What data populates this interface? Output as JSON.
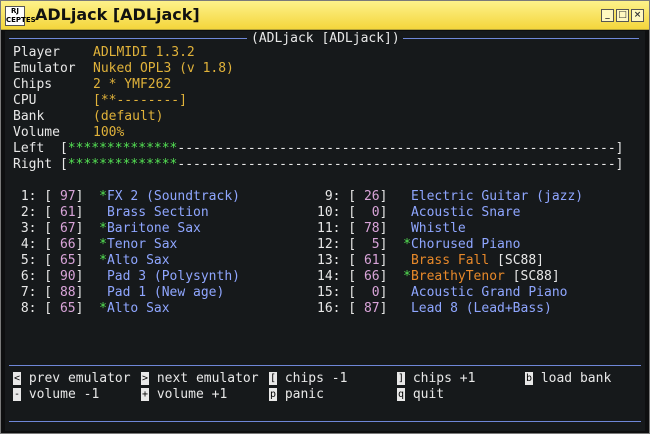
{
  "window": {
    "title": "ADLjack [ADLjack]",
    "app_icon_text": "RJ CEPTES"
  },
  "header": {
    "title": "(ADLjack [ADLjack])"
  },
  "info": [
    {
      "label": "Player",
      "value": "ADLMIDI 1.3.2"
    },
    {
      "label": "Emulator",
      "value": "Nuked OPL3 (v 1.8)"
    },
    {
      "label": "Chips",
      "value": "2 * YMF262"
    },
    {
      "label": "CPU",
      "value": "[**--------]"
    },
    {
      "label": "Bank",
      "value": "(default)"
    },
    {
      "label": "Volume",
      "value": "100%"
    }
  ],
  "meters": {
    "left": {
      "label": "Left",
      "bar_open": "[",
      "fill": "**************",
      "rest": "--------------------------------------------------------",
      "bar_close": "]"
    },
    "right": {
      "label": "Right",
      "bar_open": "[",
      "fill": "**************",
      "rest": "--------------------------------------------------------",
      "bar_close": "]"
    }
  },
  "channels_left": [
    {
      "num": "1:",
      "vol": "97",
      "active": true,
      "name": "FX 2 (Soundtrack)",
      "tag": ""
    },
    {
      "num": "2:",
      "vol": "61",
      "active": false,
      "name": "Brass Section",
      "tag": ""
    },
    {
      "num": "3:",
      "vol": "67",
      "active": true,
      "name": "Baritone Sax",
      "tag": ""
    },
    {
      "num": "4:",
      "vol": "66",
      "active": true,
      "name": "Tenor Sax",
      "tag": ""
    },
    {
      "num": "5:",
      "vol": "65",
      "active": true,
      "name": "Alto Sax",
      "tag": ""
    },
    {
      "num": "6:",
      "vol": "90",
      "active": false,
      "name": "Pad 3 (Polysynth)",
      "tag": ""
    },
    {
      "num": "7:",
      "vol": "88",
      "active": false,
      "name": "Pad 1 (New age)",
      "tag": ""
    },
    {
      "num": "8:",
      "vol": "65",
      "active": true,
      "name": "Alto Sax",
      "tag": ""
    }
  ],
  "channels_right": [
    {
      "num": "9:",
      "vol": "26",
      "active": false,
      "name": "Electric Guitar (jazz)",
      "tag": ""
    },
    {
      "num": "10:",
      "vol": "0",
      "active": false,
      "name": "Acoustic Snare",
      "tag": ""
    },
    {
      "num": "11:",
      "vol": "78",
      "active": false,
      "name": "Whistle",
      "tag": ""
    },
    {
      "num": "12:",
      "vol": "5",
      "active": true,
      "name": "Chorused Piano",
      "tag": ""
    },
    {
      "num": "13:",
      "vol": "61",
      "active": false,
      "name": "Brass Fall",
      "tag": "[SC88]"
    },
    {
      "num": "14:",
      "vol": "66",
      "active": true,
      "name": "BreathyTenor",
      "tag": "[SC88]"
    },
    {
      "num": "15:",
      "vol": "0",
      "active": false,
      "name": "Acoustic Grand Piano",
      "tag": ""
    },
    {
      "num": "16:",
      "vol": "87",
      "active": false,
      "name": "Lead 8 (Lead+Bass)",
      "tag": ""
    }
  ],
  "keys": [
    {
      "key": "<",
      "label": "prev emulator"
    },
    {
      "key": ">",
      "label": "next emulator"
    },
    {
      "key": "[",
      "label": "chips -1"
    },
    {
      "key": "]",
      "label": "chips +1"
    },
    {
      "key": "b",
      "label": "load bank"
    },
    {
      "key": "-",
      "label": "volume -1"
    },
    {
      "key": "+",
      "label": "volume +1"
    },
    {
      "key": "p",
      "label": "panic"
    },
    {
      "key": "q",
      "label": "quit"
    }
  ],
  "colors": {
    "title_bar": "#f4d63c",
    "value": "#e0b23a",
    "instrument": "#8fa6ff",
    "active_mark": "#54e354",
    "volume": "#d9a4d9",
    "sc88": "#e8892a"
  }
}
